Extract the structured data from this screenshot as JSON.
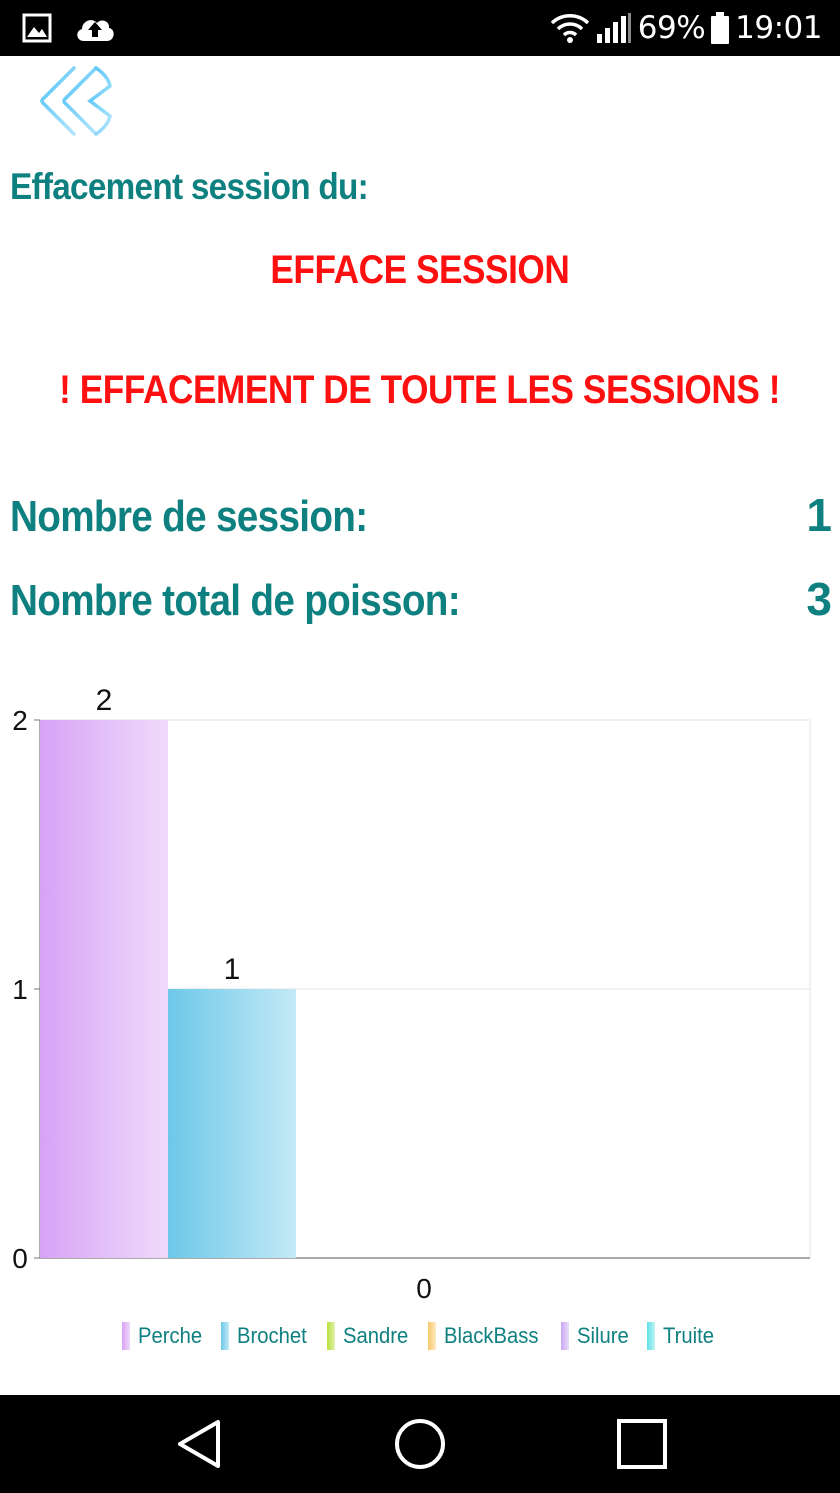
{
  "status_bar": {
    "battery": "69%",
    "time": "19:01",
    "icons": [
      "image-icon",
      "cloud-upload-icon",
      "wifi-icon",
      "signal-icon",
      "battery-icon"
    ]
  },
  "header": {
    "back_icon": "double-chevron-left-icon"
  },
  "main": {
    "heading": "Effacement session du:",
    "erase_session": "EFFACE SESSION",
    "erase_all": "! EFFACEMENT DE TOUTE LES SESSIONS !",
    "session_count_label": "Nombre de session:",
    "session_count_value": "1",
    "fish_total_label": "Nombre total de poisson:",
    "fish_total_value": "3"
  },
  "chart_data": {
    "type": "bar",
    "categories": [
      "0"
    ],
    "series": [
      {
        "name": "Perche",
        "values": [
          2
        ],
        "color": "#d7a3f5"
      },
      {
        "name": "Brochet",
        "values": [
          1
        ],
        "color": "#6cc8e8"
      },
      {
        "name": "Sandre",
        "values": [
          0
        ],
        "color": "#b7e03a"
      },
      {
        "name": "BlackBass",
        "values": [
          0
        ],
        "color": "#f7c96a"
      },
      {
        "name": "Silure",
        "values": [
          0
        ],
        "color": "#c9a7f2"
      },
      {
        "name": "Truite",
        "values": [
          0
        ],
        "color": "#5fe0e8"
      }
    ],
    "yticks": [
      "0",
      "1",
      "2"
    ],
    "ylim": [
      0,
      2
    ],
    "data_labels": [
      "2",
      "1"
    ],
    "grid": true,
    "legend": "bottom"
  },
  "nav_bar": {
    "icons": [
      "back-triangle-icon",
      "home-circle-icon",
      "recents-square-icon"
    ]
  }
}
